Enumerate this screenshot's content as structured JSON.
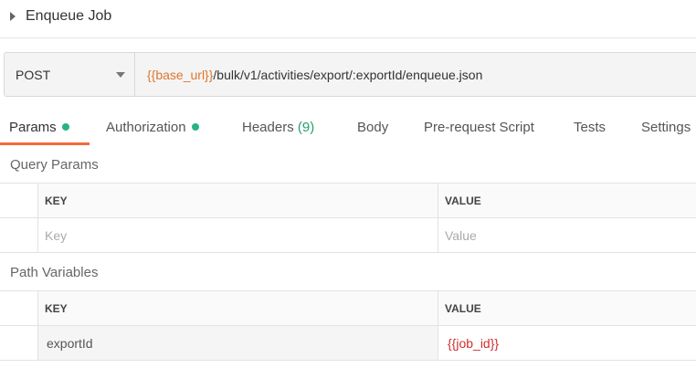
{
  "request": {
    "name": "Enqueue Job"
  },
  "url_bar": {
    "method": "POST",
    "url_var": "{{base_url}}",
    "url_path": "/bulk/v1/activities/export/:exportId/enqueue.json"
  },
  "tabs": [
    {
      "label": "Params",
      "indicator": "green-dot"
    },
    {
      "label": "Authorization",
      "indicator": "green-dot"
    },
    {
      "label": "Headers",
      "count": "(9)"
    },
    {
      "label": "Body"
    },
    {
      "label": "Pre-request Script"
    },
    {
      "label": "Tests"
    },
    {
      "label": "Settings"
    }
  ],
  "active_tab": "Params",
  "colors": {
    "accent": "#f26b3a",
    "variable": "#e0752d",
    "indicator": "#26b47f",
    "path_value": "#d22d2d"
  },
  "query_params": {
    "label": "Query Params",
    "header_key": "KEY",
    "header_value": "VALUE",
    "key_placeholder": "Key",
    "value_placeholder": "Value"
  },
  "path_variables": {
    "label": "Path Variables",
    "header_key": "KEY",
    "header_value": "VALUE",
    "rows": [
      {
        "key": "exportId",
        "value": "{{job_id}}"
      }
    ]
  }
}
